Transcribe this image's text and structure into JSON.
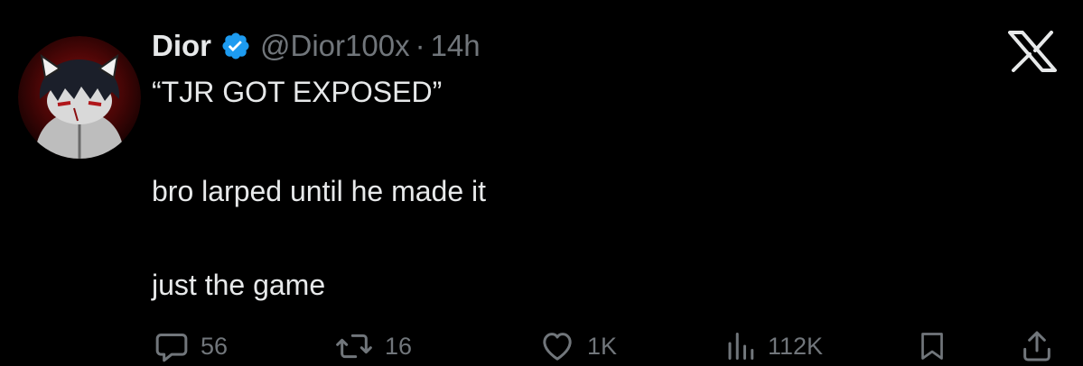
{
  "author": {
    "name": "Dior",
    "handle": "@Dior100x",
    "separator": "·",
    "time": "14h",
    "verified_color": "#1d9bf0"
  },
  "tweet": {
    "lines": [
      "“TJR GOT EXPOSED”",
      "bro larped until he made it",
      "just the game"
    ]
  },
  "actions": {
    "reply": {
      "icon": "reply-icon",
      "count": "56"
    },
    "repost": {
      "icon": "repost-icon",
      "count": "16"
    },
    "like": {
      "icon": "heart-icon",
      "count": "1K"
    },
    "views": {
      "icon": "views-icon",
      "count": "112K"
    },
    "bookmark": {
      "icon": "bookmark-icon"
    },
    "share": {
      "icon": "share-icon"
    }
  },
  "colors": {
    "background": "#000000",
    "text_primary": "#e7e9ea",
    "text_secondary": "#71767b",
    "accent": "#1d9bf0"
  }
}
